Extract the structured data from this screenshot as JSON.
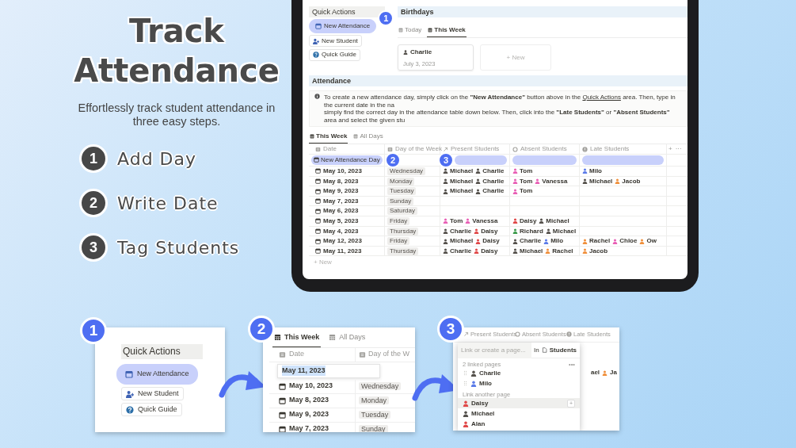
{
  "hero": {
    "title_lines": [
      "Track",
      "Attendance"
    ],
    "subtitle": "Effortlessly track student attendance in three easy steps.",
    "steps": [
      {
        "number": "1",
        "label": "Add Day"
      },
      {
        "number": "2",
        "label": "Write Date"
      },
      {
        "number": "3",
        "label": "Tag Students"
      }
    ]
  },
  "tablet": {
    "quick_actions": {
      "title": "Quick Actions",
      "buttons": [
        {
          "label": "New Attendance",
          "highlighted": true,
          "callout": "1"
        },
        {
          "label": "New Student",
          "highlighted": false
        },
        {
          "label": "Quick Guide",
          "highlighted": false
        }
      ]
    },
    "birthdays": {
      "title": "Birthdays",
      "tabs": [
        {
          "label": "Today",
          "selected": false
        },
        {
          "label": "This Week",
          "selected": true
        }
      ],
      "cards": [
        {
          "name": "Charlie",
          "date": "July 3, 2023"
        }
      ],
      "new_card": "+ New"
    },
    "attendance": {
      "title": "Attendance",
      "info": {
        "before_link": "To create a new attendance day, simply click on the **\"New Attendance\"** button above in the ",
        "link": "Quick Actions",
        "after_link": " area. Then, type in the current date in the na",
        "second_line": "simply find the correct day in the attendance table down below. Then, click into the **\"Late Students\"** or **\"Absent Students\"** area and select the given stu"
      },
      "views": [
        {
          "label": "This Week",
          "selected": true
        },
        {
          "label": "All Days",
          "selected": false
        }
      ],
      "columns": [
        {
          "label": "Date",
          "kind": "date"
        },
        {
          "label": "Day of the Week",
          "kind": "select"
        },
        {
          "label": "Present Students",
          "kind": "relation"
        },
        {
          "label": "Absent Students",
          "kind": "absent"
        },
        {
          "label": "Late Students",
          "kind": "late"
        }
      ],
      "add_column": "+",
      "more": "···",
      "new_row": {
        "label": "New Attendance Day",
        "callout": "2",
        "pill_callout": "3"
      },
      "rows": [
        {
          "cells": [
            "May 10, 2023",
            "Wednesday",
            [
              {
                "name": "Michael",
                "color": "#55514c"
              },
              {
                "name": "Charlie",
                "color": "#55514c"
              }
            ],
            [
              {
                "name": "Tom",
                "color": "#e85fb5"
              }
            ],
            [
              {
                "name": "Milo",
                "color": "#5b7be8"
              }
            ]
          ]
        },
        {
          "cells": [
            "May 8, 2023",
            "Monday",
            [
              {
                "name": "Michael",
                "color": "#55514c"
              },
              {
                "name": "Charlie",
                "color": "#55514c"
              }
            ],
            [
              {
                "name": "Tom",
                "color": "#e85fb5"
              },
              {
                "name": "Vanessa",
                "color": "#e85fb5"
              }
            ],
            [
              {
                "name": "Michael",
                "color": "#55514c"
              },
              {
                "name": "Jacob",
                "color": "#f0903c"
              }
            ]
          ]
        },
        {
          "cells": [
            "May 9, 2023",
            "Tuesday",
            [
              {
                "name": "Michael",
                "color": "#55514c"
              },
              {
                "name": "Charlie",
                "color": "#55514c"
              }
            ],
            [
              {
                "name": "Tom",
                "color": "#e85fb5"
              }
            ],
            []
          ]
        },
        {
          "cells": [
            "May 7, 2023",
            "Sunday",
            [],
            [],
            []
          ]
        },
        {
          "cells": [
            "May 6, 2023",
            "Saturday",
            [],
            [],
            []
          ]
        },
        {
          "cells": [
            "May 5, 2023",
            "Friday",
            [
              {
                "name": "Tom",
                "color": "#e85fb5"
              },
              {
                "name": "Vanessa",
                "color": "#e85fb5"
              }
            ],
            [
              {
                "name": "Daisy",
                "color": "#e04848"
              },
              {
                "name": "Michael",
                "color": "#55514c"
              }
            ],
            []
          ]
        },
        {
          "cells": [
            "May 4, 2023",
            "Thursday",
            [
              {
                "name": "Charlie",
                "color": "#55514c"
              },
              {
                "name": "Daisy",
                "color": "#e04848"
              }
            ],
            [
              {
                "name": "Richard",
                "color": "#3a9a4a"
              },
              {
                "name": "Michael",
                "color": "#55514c"
              }
            ],
            []
          ]
        },
        {
          "cells": [
            "May 12, 2023",
            "Friday",
            [
              {
                "name": "Michael",
                "color": "#55514c"
              },
              {
                "name": "Daisy",
                "color": "#e04848"
              }
            ],
            [
              {
                "name": "Charlie",
                "color": "#55514c"
              },
              {
                "name": "Milo",
                "color": "#5b7be8"
              }
            ],
            [
              {
                "name": "Rachel",
                "color": "#f0903c"
              },
              {
                "name": "Chloe",
                "color": "#e85fb5"
              },
              {
                "name": "Ow",
                "color": "#f0903c"
              }
            ]
          ]
        },
        {
          "cells": [
            "May 11, 2023",
            "Thursday",
            [
              {
                "name": "Charlie",
                "color": "#55514c"
              },
              {
                "name": "Daisy",
                "color": "#e04848"
              }
            ],
            [
              {
                "name": "Michael",
                "color": "#55514c"
              },
              {
                "name": "Rachel",
                "color": "#f0903c"
              }
            ],
            [
              {
                "name": "Jacob",
                "color": "#f0903c"
              }
            ]
          ]
        }
      ],
      "new_label": "+ New"
    }
  },
  "steps_detail": [
    {
      "kind": "quick_actions",
      "callout": "1",
      "title": "Quick Actions",
      "buttons": [
        {
          "label": "New Attendance",
          "highlighted": true
        },
        {
          "label": "New Student",
          "highlighted": false
        },
        {
          "label": "Quick Guide",
          "highlighted": false
        }
      ]
    },
    {
      "kind": "date_entry",
      "callout": "2",
      "tabs": [
        {
          "label": "This Week",
          "selected": true
        },
        {
          "label": "All Days",
          "selected": false
        }
      ],
      "columns": [
        "Date",
        "Day of the W"
      ],
      "input_value": "May 11, 2023",
      "rows": [
        {
          "cells": [
            "May 10, 2023",
            "Wednesday"
          ]
        },
        {
          "cells": [
            "May 8, 2023",
            "Monday"
          ]
        },
        {
          "cells": [
            "May 9, 2023",
            "Tuesday"
          ]
        },
        {
          "cells": [
            "May 7, 2023",
            "Sunday"
          ]
        }
      ]
    },
    {
      "kind": "tag_picker",
      "callout": "3",
      "columns": [
        {
          "label": "Present Students",
          "kind": "relation"
        },
        {
          "label": "Absent Students",
          "kind": "absent"
        },
        {
          "label": "Late Students",
          "kind": "late"
        }
      ],
      "background_cells": [
        {
          "text": "ael"
        },
        {
          "text": "Ja",
          "color": "#f0903c"
        }
      ],
      "search_placeholder": "Link or create a page...",
      "scope_prefix": "In",
      "scope": "Students",
      "linked_heading": "2 linked pages",
      "more": "•••",
      "linked": [
        {
          "name": "Charlie",
          "color": "#55514c"
        },
        {
          "name": "Milo",
          "color": "#5b7be8"
        }
      ],
      "other_heading": "Link another page",
      "add_label": "+",
      "others": [
        {
          "name": "Daisy",
          "color": "#e04848",
          "highlighted": true
        },
        {
          "name": "Michael",
          "color": "#55514c",
          "highlighted": false
        },
        {
          "name": "Alan",
          "color": "#e04848",
          "highlighted": false
        }
      ]
    }
  ]
}
